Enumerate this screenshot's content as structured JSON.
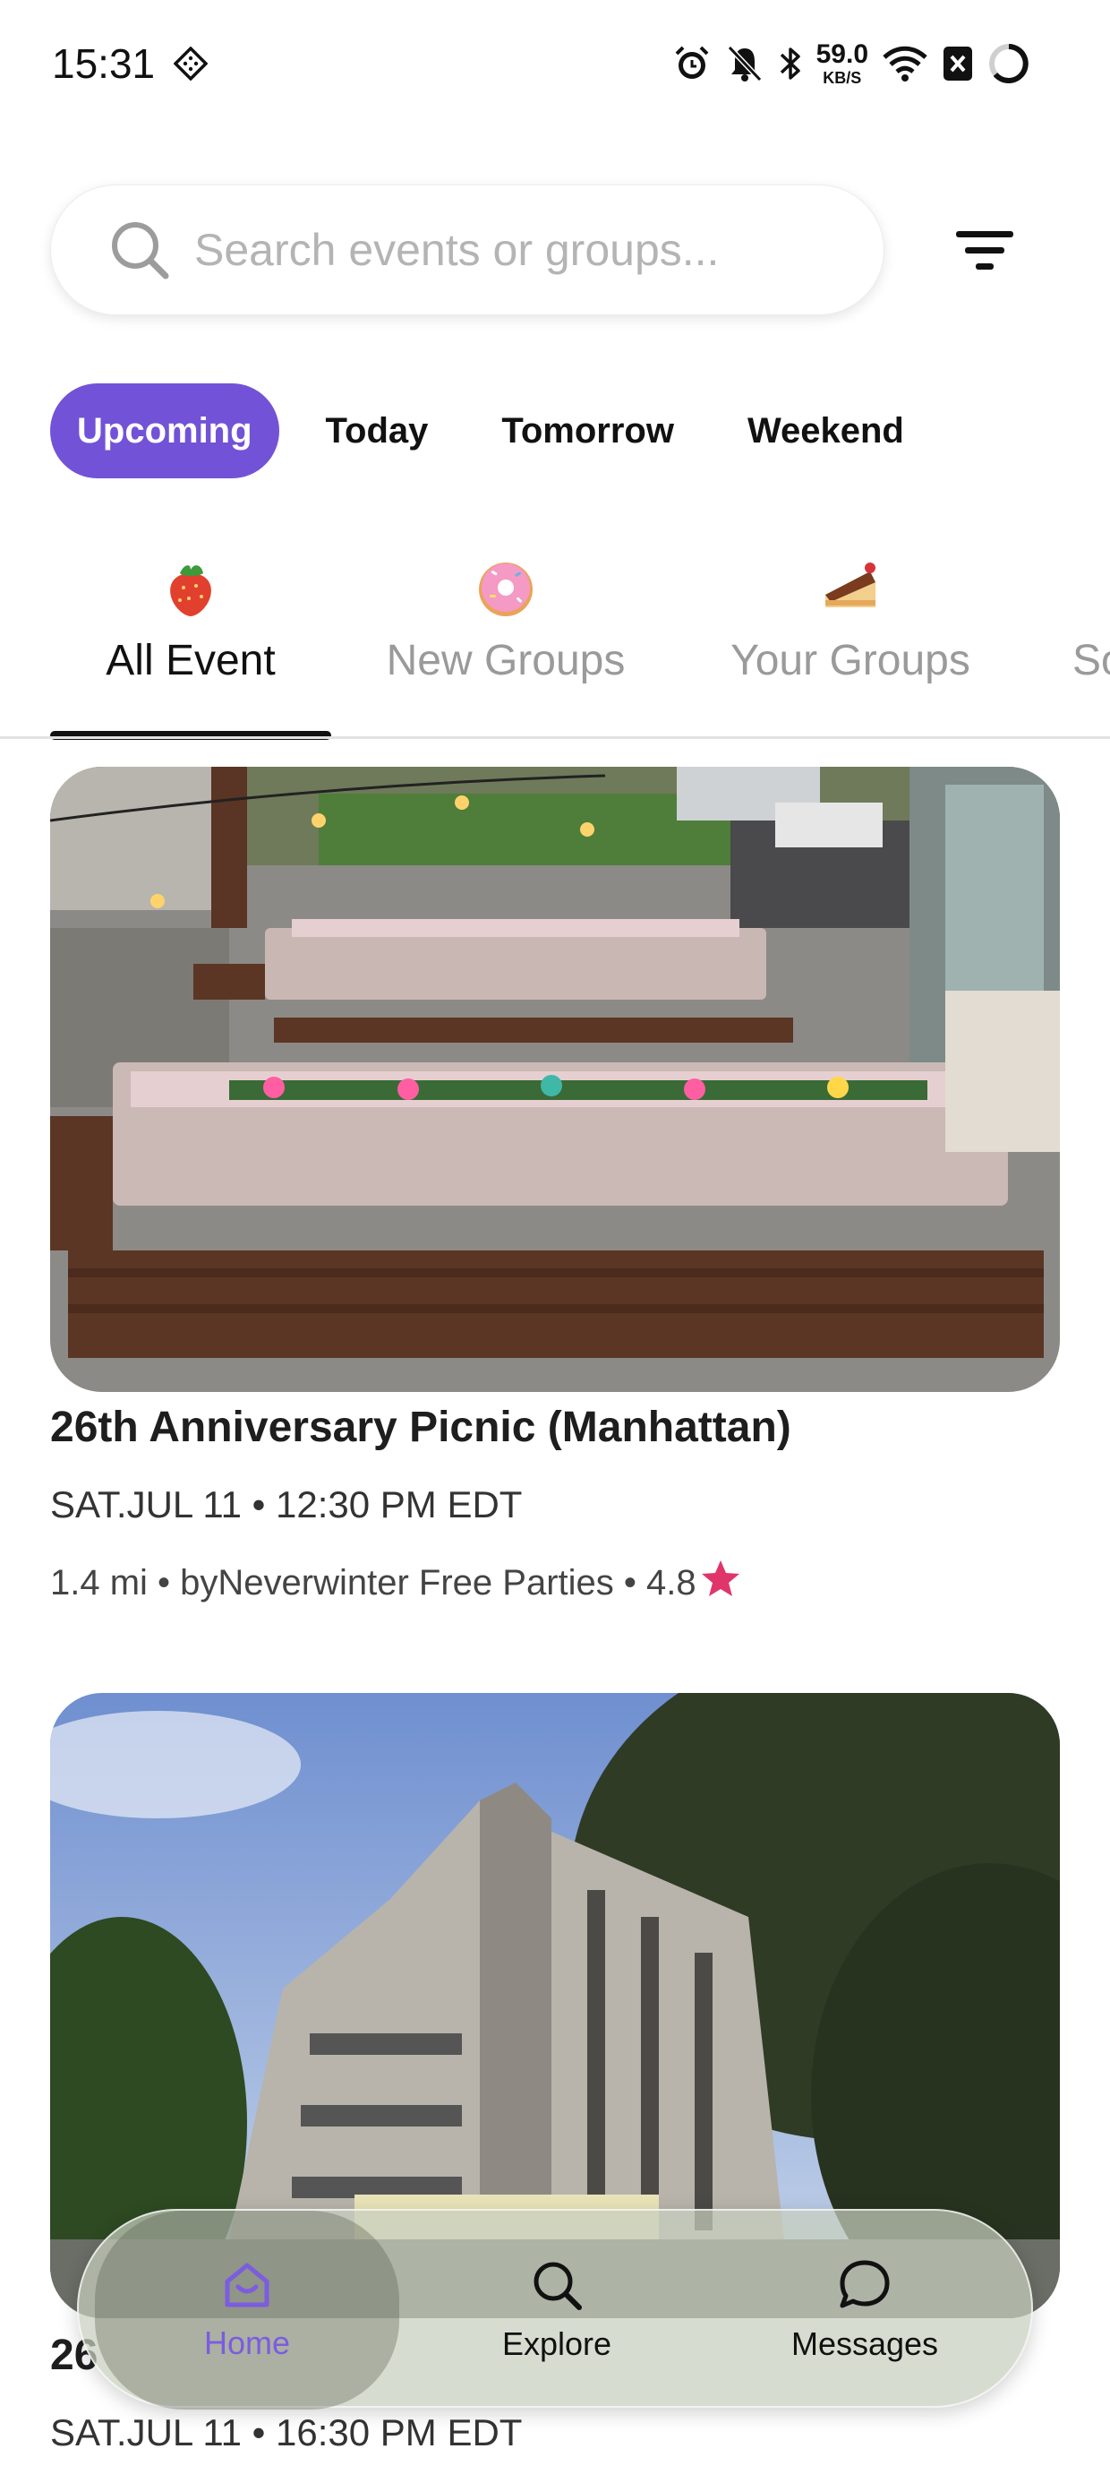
{
  "status_bar": {
    "time": "15:31",
    "net_speed_value": "59.0",
    "net_speed_unit": "KB/S",
    "icons": [
      "alarm-icon",
      "bell-off-icon",
      "bluetooth-icon",
      "wifi-icon",
      "battery-saver-icon",
      "battery-ring-icon"
    ]
  },
  "search": {
    "placeholder": "Search events or groups..."
  },
  "time_filters": [
    {
      "label": "Upcoming",
      "active": true
    },
    {
      "label": "Today",
      "active": false
    },
    {
      "label": "Tomorrow",
      "active": false
    },
    {
      "label": "Weekend",
      "active": false
    }
  ],
  "category_tabs": [
    {
      "label": "All Event",
      "icon": "strawberry-icon",
      "active": true
    },
    {
      "label": "New Groups",
      "icon": "donut-icon",
      "active": false
    },
    {
      "label": "Your Groups",
      "icon": "cake-slice-icon",
      "active": false
    },
    {
      "label": "So",
      "icon": "",
      "active": false
    }
  ],
  "events": [
    {
      "image": "outdoor-picnic-tables-photo",
      "title": "26th Anniversary Picnic (Manhattan)",
      "date": "SAT.JUL 11 • 12:30 PM EDT",
      "distance": "1.4 mi",
      "organizer": "byNeverwinter Free Parties",
      "rating": "4.8"
    },
    {
      "image": "apartment-building-trees-photo",
      "title": "26",
      "date": "SAT.JUL 11 • 16:30 PM EDT"
    }
  ],
  "bottom_nav": [
    {
      "label": "Home",
      "icon": "home-icon",
      "active": true
    },
    {
      "label": "Explore",
      "icon": "search-icon",
      "active": false
    },
    {
      "label": "Messages",
      "icon": "chat-bubble-icon",
      "active": false
    }
  ],
  "colors": {
    "accent": "#7252d6",
    "star": "#e0356a"
  }
}
